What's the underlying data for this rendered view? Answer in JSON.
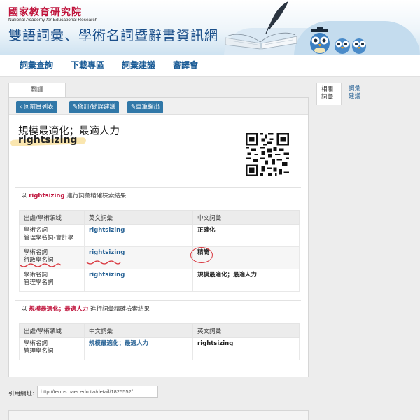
{
  "header": {
    "org_name_cn": "國家教育研究院",
    "org_name_en_prefix": "National Academy",
    "org_name_en_for": "for",
    "org_name_en_suffix": "Educational Research",
    "site_title": "雙語詞彙、學術名詞暨辭書資訊網"
  },
  "nav": {
    "items": [
      "詞彙查詢",
      "下載專區",
      "詞彙建議",
      "審譯會"
    ]
  },
  "main_tab": "翻譯",
  "toolbar": {
    "back": "回前目列表",
    "suggest": "修訂/勘誤建議",
    "export": "單筆輸出"
  },
  "term": {
    "chinese": "規模最適化；最適人力",
    "english": "rightsizing"
  },
  "section1": {
    "prefix": "以",
    "keyword": "rightsizing",
    "suffix": "進行詞彙精確檢索結果",
    "headers": [
      "出處/學術領域",
      "英文詞彙",
      "中文詞彙"
    ],
    "rows": [
      {
        "source1": "學術名詞",
        "source2": "管理學名詞-會計學",
        "english": "rightsizing",
        "chinese": "正確化"
      },
      {
        "source1": "學術名詞",
        "source2": "行政學名詞",
        "english": "rightsizing",
        "chinese": "精簡"
      },
      {
        "source1": "學術名詞",
        "source2": "管理學名詞",
        "english": "rightsizing",
        "chinese": "規模最適化；最適人力"
      }
    ]
  },
  "section2": {
    "prefix": "以",
    "keyword": "規模最適化；最適人力",
    "suffix": "進行詞彙精確檢索結果",
    "headers": [
      "出處/學術領域",
      "中文詞彙",
      "英文詞彙"
    ],
    "rows": [
      {
        "source1": "學術名詞",
        "source2": "管理學名詞",
        "chinese": "規模最適化；最適人力",
        "english": "rightsizing"
      }
    ]
  },
  "cite": {
    "label": "引用網址:",
    "url": "http://terms.naer.edu.tw/detail/1825552/"
  },
  "side_tabs": {
    "active_line1": "相關",
    "active_line2": "詞彙",
    "inactive_line1": "詞彙",
    "inactive_line2": "建議"
  },
  "colors": {
    "brand_red": "#c0143c",
    "nav_blue": "#1a5b96",
    "button_blue": "#3178a8",
    "annotation_red": "#d9363e"
  }
}
